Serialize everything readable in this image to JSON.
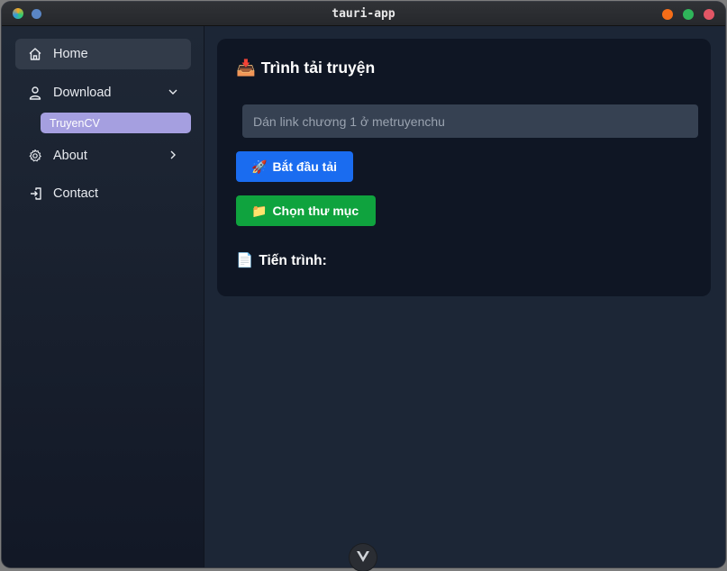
{
  "window": {
    "title": "tauri-app"
  },
  "sidebar": {
    "items": [
      {
        "label": "Home",
        "icon": "home-icon",
        "active": true
      },
      {
        "label": "Download",
        "icon": "user-icon",
        "expanded": true
      },
      {
        "label": "About",
        "icon": "gear-icon",
        "collapsed": true
      },
      {
        "label": "Contact",
        "icon": "logout-icon"
      }
    ],
    "sub_items": [
      {
        "label": "TruyenCV"
      }
    ]
  },
  "main": {
    "title_emoji": "📥",
    "title": "Trình tải truyện",
    "url_input": {
      "placeholder": "Dán link chương 1 ở metruyenchu",
      "value": ""
    },
    "start_button": {
      "emoji": "🚀",
      "label": "Bắt đầu tải"
    },
    "folder_button": {
      "emoji": "📁",
      "label": "Chọn thư mục"
    },
    "progress": {
      "emoji": "📄",
      "label": "Tiến trình:"
    }
  },
  "colors": {
    "accent_blue": "#1a6cf0",
    "accent_green": "#0fa33e",
    "sub_item_bg": "#a59fe0"
  }
}
